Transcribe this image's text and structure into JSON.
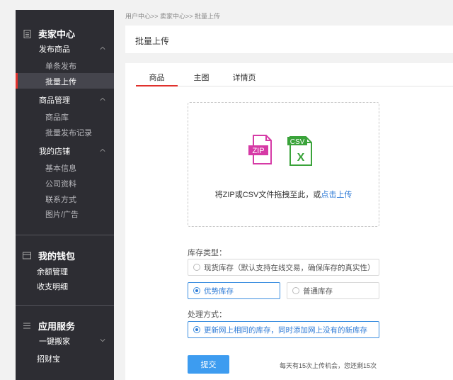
{
  "sidebar": {
    "seller_center": {
      "title": "卖家中心",
      "icon": "document-icon"
    },
    "publish": {
      "label": "发布商品",
      "items": [
        "单条发布",
        "批量上传"
      ],
      "active_index": 1
    },
    "goods": {
      "label": "商品管理",
      "items": [
        "商品库",
        "批量发布记录"
      ]
    },
    "shop": {
      "label": "我的店铺",
      "items": [
        "基本信息",
        "公司资料",
        "联系方式",
        "图片/广告"
      ]
    },
    "wallet": {
      "title": "我的钱包",
      "icon": "wallet-icon",
      "items": [
        "余额管理",
        "收支明细"
      ]
    },
    "apps": {
      "title": "应用服务",
      "icon": "list-icon",
      "group": "一键搬家",
      "extra": "招财宝"
    }
  },
  "breadcrumb": "用户中心>> 卖家中心>> 批量上传",
  "page_title": "批量上传",
  "tabs": [
    "商品",
    "主图",
    "详情页"
  ],
  "active_tab": 0,
  "dropzone": {
    "zip_label": "ZIP",
    "csv_label": "CSV",
    "csv_mark": "X",
    "text": "将ZIP或CSV文件拖拽至此，或",
    "link": "点击上传"
  },
  "stock_type": {
    "label": "库存类型：",
    "options": [
      "现货库存（默认支持在线交易，确保库存的真实性）",
      "优势库存",
      "普通库存"
    ],
    "selected_index": 1
  },
  "handling": {
    "label": "处理方式：",
    "options": [
      "更新网上相同的库存，同时添加网上没有的新库存"
    ],
    "selected_index": 0
  },
  "submit_label": "提交",
  "quota_note": "每天有15次上传机会，您还剩15次",
  "colors": {
    "accent_red": "#e0312c",
    "accent_blue": "#2d7ad6",
    "zip_magenta": "#d63aa6",
    "csv_green": "#3aa33a",
    "sidebar_bg": "#2d2d33"
  }
}
